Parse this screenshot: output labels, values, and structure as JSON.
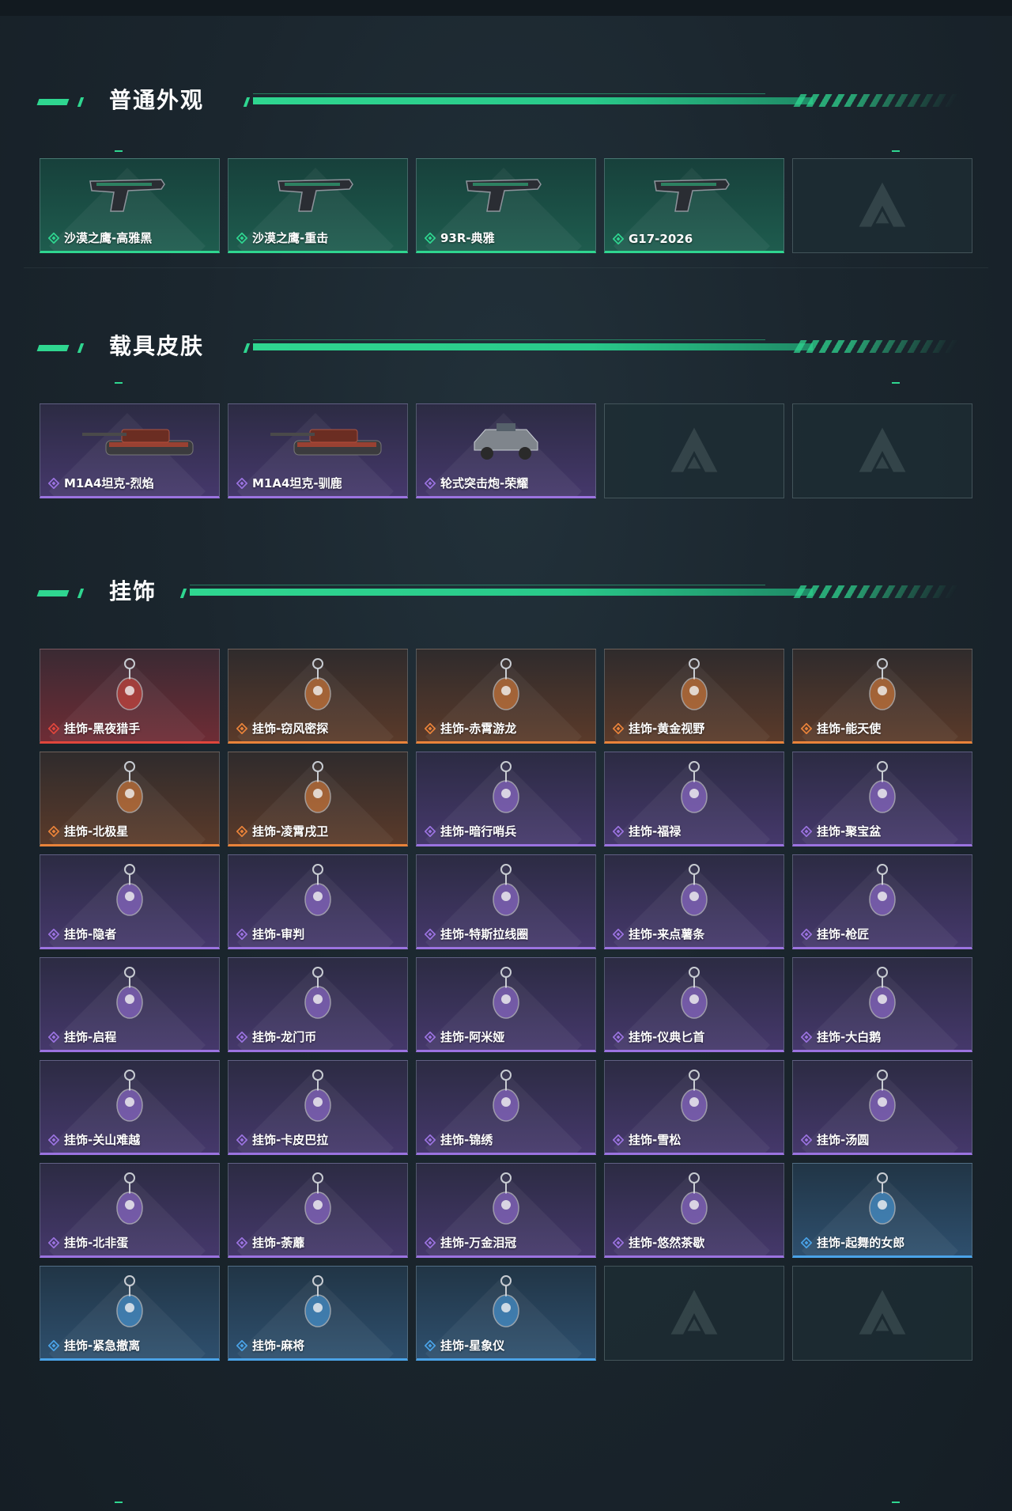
{
  "sections": [
    {
      "id": "normal",
      "title": "普通外观",
      "items": [
        {
          "label": "沙漠之鹰-高雅黑",
          "rarity": "green",
          "icon": "pistol-icon"
        },
        {
          "label": "沙漠之鹰-重击",
          "rarity": "green",
          "icon": "pistol-icon"
        },
        {
          "label": "93R-典雅",
          "rarity": "green",
          "icon": "pistol-icon"
        },
        {
          "label": "G17-2026",
          "rarity": "green",
          "icon": "pistol-icon"
        },
        {
          "label": "",
          "rarity": "empty",
          "icon": "empty-slot-icon"
        }
      ]
    },
    {
      "id": "vehicle",
      "title": "载具皮肤",
      "items": [
        {
          "label": "M1A4坦克-烈焰",
          "rarity": "purple",
          "icon": "tank-icon"
        },
        {
          "label": "M1A4坦克-驯鹿",
          "rarity": "purple",
          "icon": "tank-icon"
        },
        {
          "label": "轮式突击炮-荣耀",
          "rarity": "purple",
          "icon": "armored-car-icon"
        },
        {
          "label": "",
          "rarity": "empty",
          "icon": "empty-slot-icon"
        },
        {
          "label": "",
          "rarity": "empty",
          "icon": "empty-slot-icon"
        }
      ]
    },
    {
      "id": "charm",
      "title": "挂饰",
      "items": [
        {
          "label": "挂饰-黑夜猎手",
          "rarity": "red",
          "icon": "charm-icon"
        },
        {
          "label": "挂饰-窃风密探",
          "rarity": "orange",
          "icon": "charm-icon"
        },
        {
          "label": "挂饰-赤霄游龙",
          "rarity": "orange",
          "icon": "charm-icon"
        },
        {
          "label": "挂饰-黄金视野",
          "rarity": "orange",
          "icon": "charm-icon"
        },
        {
          "label": "挂饰-能天使",
          "rarity": "orange",
          "icon": "charm-icon"
        },
        {
          "label": "挂饰-北极星",
          "rarity": "orange",
          "icon": "charm-icon"
        },
        {
          "label": "挂饰-凌霄戌卫",
          "rarity": "orange",
          "icon": "charm-icon"
        },
        {
          "label": "挂饰-暗行哨兵",
          "rarity": "purple",
          "icon": "charm-icon"
        },
        {
          "label": "挂饰-福禄",
          "rarity": "purple",
          "icon": "charm-icon"
        },
        {
          "label": "挂饰-聚宝盆",
          "rarity": "purple",
          "icon": "charm-icon"
        },
        {
          "label": "挂饰-隐者",
          "rarity": "purple",
          "icon": "charm-icon"
        },
        {
          "label": "挂饰-审判",
          "rarity": "purple",
          "icon": "charm-icon"
        },
        {
          "label": "挂饰-特斯拉线圈",
          "rarity": "purple",
          "icon": "charm-icon"
        },
        {
          "label": "挂饰-来点薯条",
          "rarity": "purple",
          "icon": "charm-icon"
        },
        {
          "label": "挂饰-枪匠",
          "rarity": "purple",
          "icon": "charm-icon"
        },
        {
          "label": "挂饰-启程",
          "rarity": "purple",
          "icon": "charm-icon"
        },
        {
          "label": "挂饰-龙门币",
          "rarity": "purple",
          "icon": "charm-icon"
        },
        {
          "label": "挂饰-阿米娅",
          "rarity": "purple",
          "icon": "charm-icon"
        },
        {
          "label": "挂饰-仪典匕首",
          "rarity": "purple",
          "icon": "charm-icon"
        },
        {
          "label": "挂饰-大白鹅",
          "rarity": "purple",
          "icon": "charm-icon"
        },
        {
          "label": "挂饰-关山难越",
          "rarity": "purple",
          "icon": "charm-icon"
        },
        {
          "label": "挂饰-卡皮巴拉",
          "rarity": "purple",
          "icon": "charm-icon"
        },
        {
          "label": "挂饰-锦绣",
          "rarity": "purple",
          "icon": "charm-icon"
        },
        {
          "label": "挂饰-雪松",
          "rarity": "purple",
          "icon": "charm-icon"
        },
        {
          "label": "挂饰-汤圆",
          "rarity": "purple",
          "icon": "charm-icon"
        },
        {
          "label": "挂饰-北非蛋",
          "rarity": "purple",
          "icon": "charm-icon"
        },
        {
          "label": "挂饰-荼蘼",
          "rarity": "purple",
          "icon": "charm-icon"
        },
        {
          "label": "挂饰-万金泪冠",
          "rarity": "purple",
          "icon": "charm-icon"
        },
        {
          "label": "挂饰-悠然茶歇",
          "rarity": "purple",
          "icon": "charm-icon"
        },
        {
          "label": "挂饰-起舞的女郎",
          "rarity": "blue",
          "icon": "charm-icon"
        },
        {
          "label": "挂饰-紧急撤离",
          "rarity": "blue",
          "icon": "charm-icon"
        },
        {
          "label": "挂饰-麻将",
          "rarity": "blue",
          "icon": "charm-icon"
        },
        {
          "label": "挂饰-星象仪",
          "rarity": "blue",
          "icon": "charm-icon"
        },
        {
          "label": "",
          "rarity": "empty",
          "icon": "empty-slot-icon"
        },
        {
          "label": "",
          "rarity": "empty",
          "icon": "empty-slot-icon"
        }
      ]
    }
  ],
  "colors": {
    "accent": "#2fd690",
    "green": "#2fd690",
    "purple": "#9b73e0",
    "red": "#e0463c",
    "orange": "#e9833a",
    "blue": "#4aa3e8"
  }
}
